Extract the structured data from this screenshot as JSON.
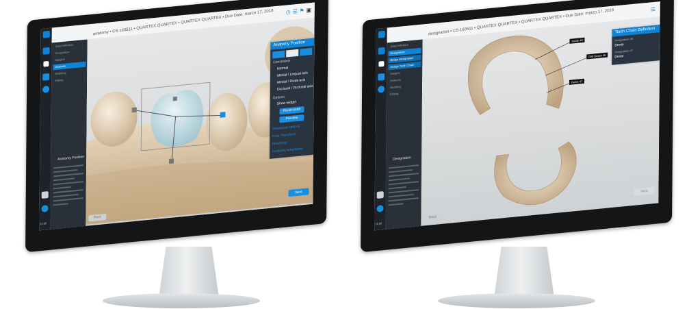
{
  "left_app": {
    "breadcrumb": "anatomy • CS 160511 • QUARTEX QUARTEX • QUARTEX QUARTEX • Due Date: marzo 17, 2018",
    "nav_items": [
      "Data Definition",
      "Designation",
      "Margins",
      "Anatomy",
      "Modeling",
      "Editing"
    ],
    "active_nav": 3,
    "panel": {
      "title": "Anatomy Position",
      "constraints_label": "Constraints",
      "constraints": [
        "Normal",
        "Mesial / Lingual axis",
        "Mesial / Distal axis",
        "Occlusal / Occlusal axis"
      ],
      "options_label": "Options",
      "show_widget": "Show widget",
      "reset_button": "Reset tooth",
      "preview_button": "Preview",
      "sections": [
        "Advanced options",
        "Free Transform",
        "Morphing",
        "Anatomy Adaptation"
      ]
    },
    "help": {
      "title": "Anatomy Position"
    },
    "back_button": "Back",
    "next_button": "Next",
    "clock": "11:50"
  },
  "right_app": {
    "breadcrumb": "designation • CS 160511 • QUARTEX QUARTEX • QUARTEX QUARTEX • Due Date: marzo 17, 2018",
    "nav_items": [
      "Data Definition",
      "Designation",
      "Bridge Designation",
      "Design Tooth Chain",
      "Margins",
      "Anatomy",
      "Modeling",
      "Editing"
    ],
    "active_nav": 1,
    "panel": {
      "title": "Tooth Chain Definition",
      "field1_label": "Designation 46",
      "field1_value": "Dente",
      "field2_label": "Designation 47",
      "field2_value": "Dente"
    },
    "tags": [
      "Dente 46",
      "Dell Crown 46",
      "Dente 47"
    ],
    "help": {
      "title": "Designation"
    },
    "back_button": "Back",
    "next_button": "Next",
    "clock": "11:50"
  },
  "colors": {
    "accent": "#1a8fe0",
    "sidebar": "#1e232a",
    "bezel": "#141517"
  }
}
